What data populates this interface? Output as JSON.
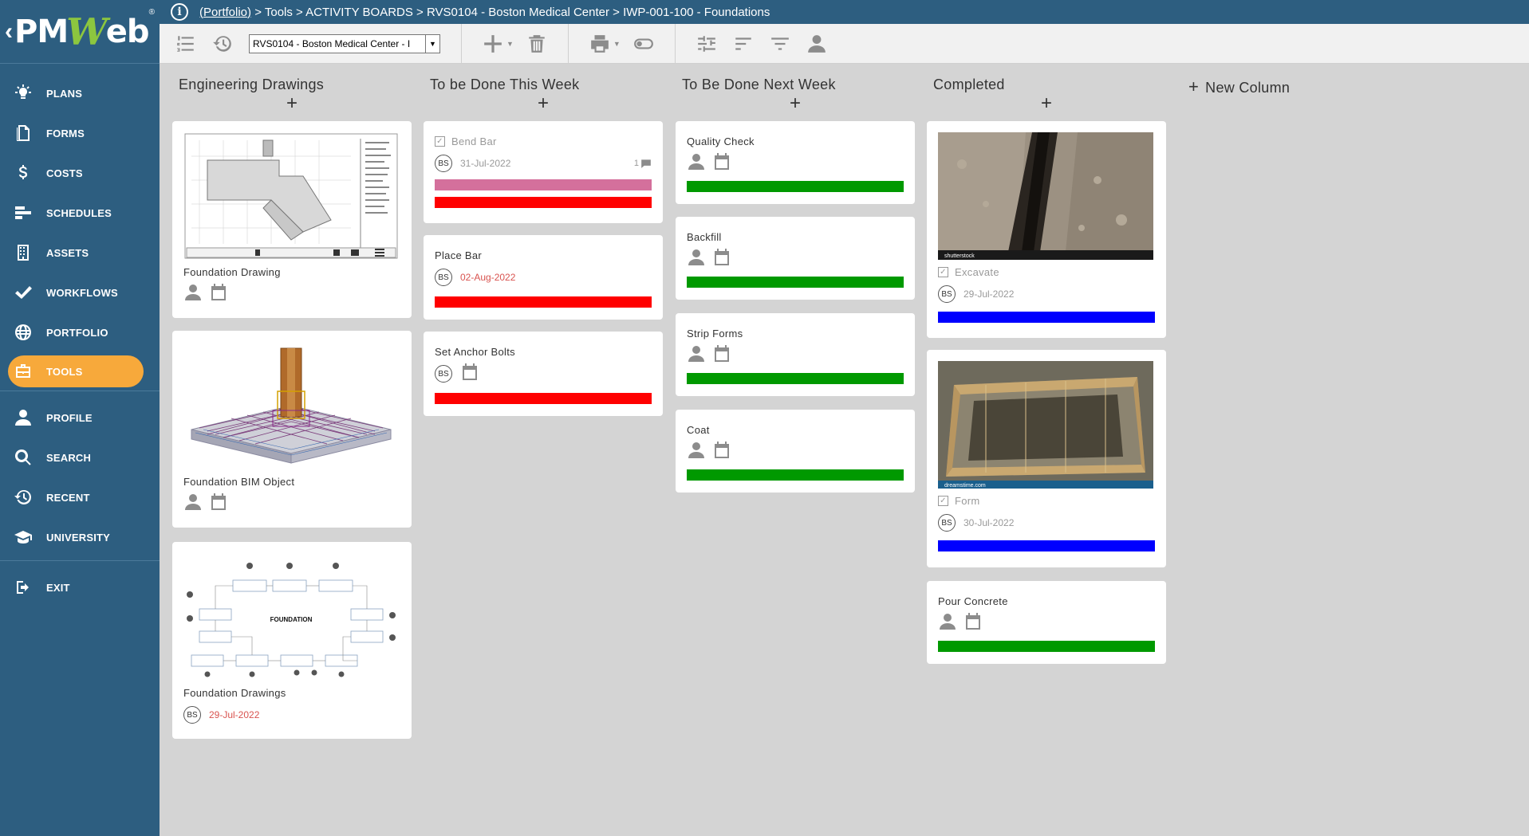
{
  "app": {
    "logo_pre": "PM",
    "logo_w": "W",
    "logo_post": "eb",
    "reg": "®"
  },
  "breadcrumb": {
    "link": "(Portfolio)",
    "rest": " > Tools > ACTIVITY BOARDS > RVS0104 - Boston Medical Center > IWP-001-100 - Foundations"
  },
  "nav": [
    {
      "label": "PLANS",
      "icon": "bulb-icon"
    },
    {
      "label": "FORMS",
      "icon": "document-icon"
    },
    {
      "label": "COSTS",
      "icon": "dollar-icon"
    },
    {
      "label": "SCHEDULES",
      "icon": "schedule-icon"
    },
    {
      "label": "ASSETS",
      "icon": "building-icon"
    },
    {
      "label": "WORKFLOWS",
      "icon": "check-icon"
    },
    {
      "label": "PORTFOLIO",
      "icon": "globe-icon"
    },
    {
      "label": "TOOLS",
      "icon": "toolbox-icon"
    },
    {
      "label": "PROFILE",
      "icon": "person-icon"
    },
    {
      "label": "SEARCH",
      "icon": "search-icon"
    },
    {
      "label": "RECENT",
      "icon": "history-icon"
    },
    {
      "label": "UNIVERSITY",
      "icon": "graduation-icon"
    },
    {
      "label": "EXIT",
      "icon": "exit-icon"
    }
  ],
  "toolbar": {
    "project_value": "RVS0104 - Boston Medical Center - I"
  },
  "colors": {
    "sidebar": "#2d5e80",
    "active": "#f7a93b",
    "red": "#ff0000",
    "pink": "#d4709c",
    "green": "#009900",
    "blue": "#0000ff"
  },
  "columns": [
    {
      "title": "Engineering Drawings",
      "add": "+",
      "cards": [
        {
          "title": "Foundation Drawing"
        },
        {
          "title": "Foundation BIM Object"
        },
        {
          "title": "Foundation Drawings",
          "initials": "BS",
          "date": "29-Jul-2022",
          "diagram_label": "FOUNDATION"
        }
      ]
    },
    {
      "title": "To be Done This Week",
      "add": "+",
      "cards": [
        {
          "title": "Bend Bar",
          "initials": "BS",
          "date": "31-Jul-2022",
          "comments": "1"
        },
        {
          "title": "Place Bar",
          "initials": "BS",
          "date": "02-Aug-2022"
        },
        {
          "title": "Set Anchor Bolts",
          "initials": "BS"
        }
      ]
    },
    {
      "title": "To Be Done Next Week",
      "add": "+",
      "cards": [
        {
          "title": "Quality Check"
        },
        {
          "title": "Backfill"
        },
        {
          "title": "Strip Forms"
        },
        {
          "title": "Coat"
        }
      ]
    },
    {
      "title": "Completed",
      "add": "+",
      "cards": [
        {
          "title": "Excavate",
          "initials": "BS",
          "date": "29-Jul-2022",
          "watermark": "shutterstock"
        },
        {
          "title": "Form",
          "initials": "BS",
          "date": "30-Jul-2022",
          "watermark": "dreamstime.com"
        },
        {
          "title": "Pour Concrete"
        }
      ]
    }
  ],
  "new_column": {
    "plus": "+",
    "label": "New Column"
  }
}
